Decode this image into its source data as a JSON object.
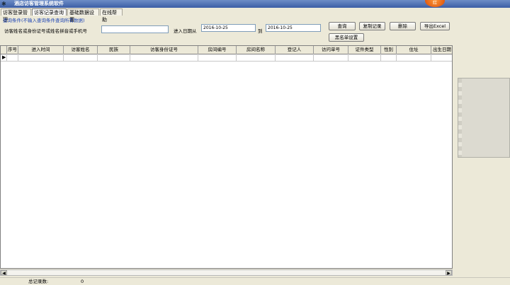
{
  "window": {
    "title": "酒店访客管理系统软件",
    "badge_text": "红"
  },
  "menu": {
    "tabs": [
      {
        "label": "访客登录管理"
      },
      {
        "label": "访客记录查询"
      },
      {
        "label": "基础数据设置"
      },
      {
        "label": "在线帮助"
      }
    ]
  },
  "query": {
    "hint": "查询条件(不输入查询条件查询所有数据)",
    "keyword_label": "访客姓名或身份证号或姓名拼音或手机号",
    "keyword_value": "",
    "date_from_label": "进入日期从",
    "date_from": "2016-10-25",
    "date_to_label": "到",
    "date_to": "2016-10-25"
  },
  "buttons": {
    "search": "查询",
    "copy": "复制记录",
    "delete": "删除",
    "export": "导出Excel",
    "blacklist": "黑名单设置"
  },
  "table": {
    "columns": [
      "序号",
      "进入时间",
      "访客姓名",
      "民族",
      "访客身份证号",
      "房间编号",
      "房间名称",
      "登记人",
      "访问单号",
      "证件类型",
      "性别",
      "住址",
      "出生日期"
    ]
  },
  "status": {
    "total_label": "总记录数:",
    "total_value": "0"
  }
}
